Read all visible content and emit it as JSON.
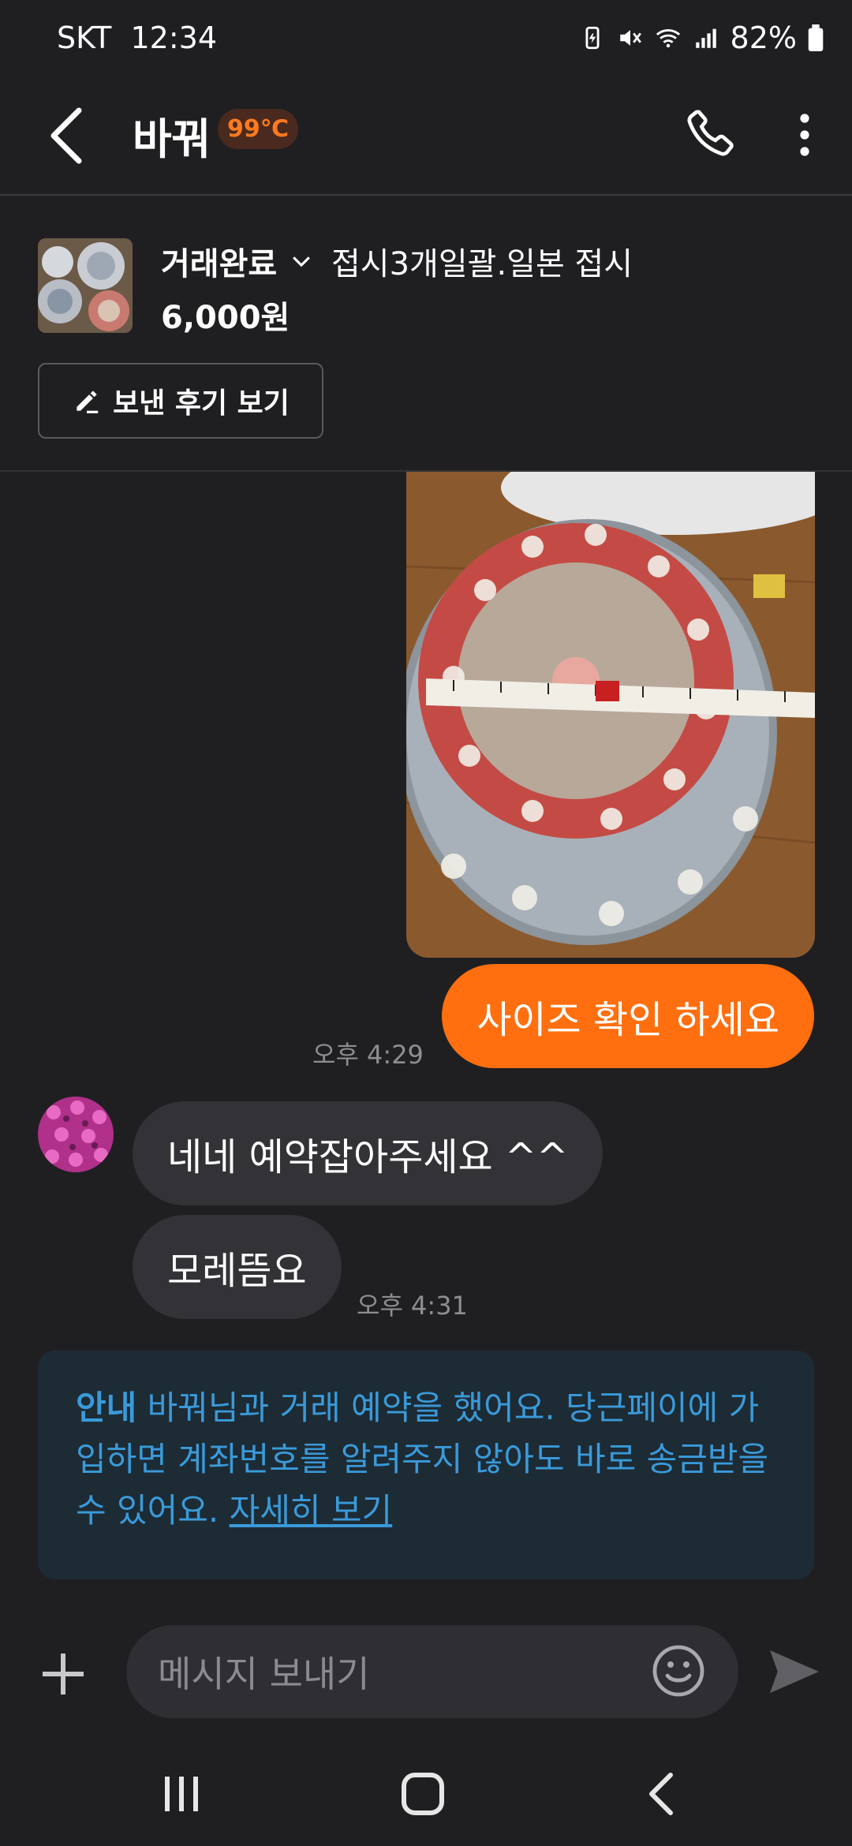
{
  "status_bar": {
    "carrier": "SKT",
    "time": "12:34",
    "battery": "82%"
  },
  "header": {
    "name": "바꿔",
    "temperature": "99℃"
  },
  "product": {
    "status": "거래완료",
    "title": "접시3개일괄.일본 접시",
    "price": "6,000원",
    "review_button": "보낸 후기 보기"
  },
  "chat": {
    "my_message": "사이즈 확인 하세요",
    "my_time": "오후 4:29",
    "other_messages": [
      "네네 예약잡아주세요 ^^",
      "모레뜸요"
    ],
    "other_time": "오후 4:31"
  },
  "notice": {
    "label": "안내",
    "text": " 바꿔님과 거래 예약을 했어요. 당근페이에 가입하면 계좌번호를 알려주지 않아도 바로 송금받을 수 있어요. ",
    "link": "자세히 보기"
  },
  "input": {
    "placeholder": "메시지 보내기"
  },
  "colors": {
    "accent": "#ff6f0f",
    "temperature": "#ff7a1f",
    "notice_text": "#3a9ad9",
    "background": "#1f1f22"
  },
  "icons": [
    "back-arrow-icon",
    "phone-icon",
    "more-vertical-icon",
    "chevron-down-icon",
    "pencil-icon",
    "plus-icon",
    "emoji-icon",
    "send-icon",
    "recent-apps-icon",
    "home-icon",
    "nav-back-icon"
  ]
}
